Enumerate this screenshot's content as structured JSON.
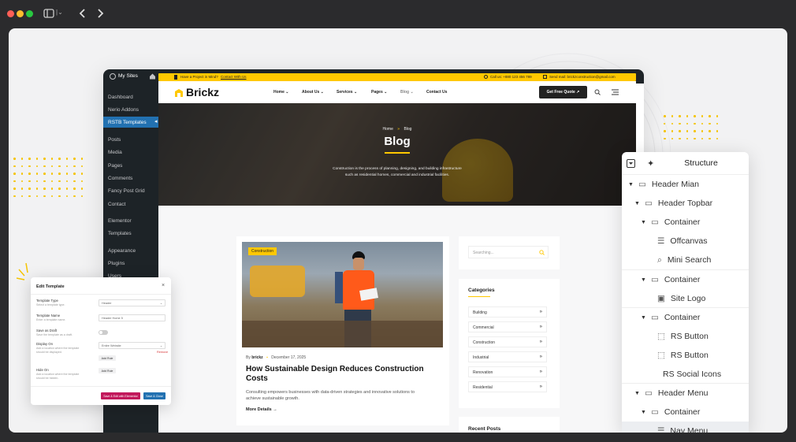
{
  "colors": {
    "accent": "#ffc800",
    "wp_dark": "#1d2327",
    "wp_active": "#2271b1",
    "pink": "#c2185b"
  },
  "browser": {
    "icons": [
      "close-dot",
      "minimize-dot",
      "maximize-dot",
      "sidebar-icon",
      "back-icon",
      "forward-icon"
    ]
  },
  "wp": {
    "my_sites": "My Sites",
    "menu": [
      "Dashboard",
      "Nerio Addons",
      "RSTB Templates",
      "Posts",
      "Media",
      "Pages",
      "Comments",
      "Fancy Post Grid",
      "Contact",
      "Elementor",
      "Templates",
      "Appearance",
      "Plugins",
      "Users"
    ]
  },
  "topbar": {
    "project": "Have a Project in Mind?",
    "contact": "Contact With Us",
    "call": "Call us: +880 123 456 789",
    "email": "Send mail: brickzconstruction@gmail.com"
  },
  "nav": {
    "logo": "Brickz",
    "links": [
      "Home",
      "About Us",
      "Services",
      "Pages",
      "Blog",
      "Contact Us"
    ],
    "cta": "Get Free Quote"
  },
  "hero": {
    "crumb_home": "Home",
    "crumb_sep": "»",
    "crumb_current": "Blog",
    "title": "Blog",
    "desc1": "Construction is the process of planning, designing, and building infrastructure",
    "desc2": "such as residential homes, commercial and industrial facilities."
  },
  "post": {
    "tag": "Construction",
    "by": "By",
    "author": "brickz",
    "date": "December 17, 2025",
    "title1": "How Sustainable Design Reduces Construction",
    "title2": "Costs",
    "excerpt1": "Consulting empowers businesses with data-driven strategies and innovative solutions to",
    "excerpt2": "achieve sustainable growth.",
    "more": "More Details"
  },
  "sidebar": {
    "search_placeholder": "Searching...",
    "categories_title": "Categories",
    "categories": [
      "Building",
      "Commercial",
      "Construction",
      "Industrial",
      "Renovation",
      "Residential"
    ],
    "recent_title": "Recent Posts"
  },
  "structure": {
    "title": "Structure",
    "items": [
      {
        "label": "Header Mian",
        "icon": "container-icon"
      },
      {
        "label": "Header Topbar",
        "icon": "container-icon"
      },
      {
        "label": "Container",
        "icon": "container-icon"
      },
      {
        "label": "Offcanvas",
        "icon": "offcanvas-icon"
      },
      {
        "label": "Mini Search",
        "icon": "search-icon"
      },
      {
        "label": "Container",
        "icon": "container-icon"
      },
      {
        "label": "Site Logo",
        "icon": "image-icon"
      },
      {
        "label": "Container",
        "icon": "container-icon"
      },
      {
        "label": "RS Button",
        "icon": "button-icon"
      },
      {
        "label": "RS Button",
        "icon": "button-icon"
      },
      {
        "label": "RS Social Icons",
        "icon": ""
      },
      {
        "label": "Header Menu",
        "icon": "container-icon"
      },
      {
        "label": "Container",
        "icon": "container-icon"
      },
      {
        "label": "Nav Menu",
        "icon": "nav-icon"
      }
    ]
  },
  "modal": {
    "title": "Edit Template",
    "type_label": "Template Type",
    "type_hint": "Select a template type.",
    "type_value": "Header",
    "name_label": "Template Name",
    "name_hint": "Enter a template name.",
    "name_value": "Header Home 5",
    "draft_label": "Save as Draft",
    "draft_hint": "Save the template as a draft.",
    "display_label": "Display On",
    "display_hint": "Add a location where the template should be displayed.",
    "display_value": "Entire Website",
    "remove": "Remove",
    "add_rule": "Add Rule",
    "hide_label": "Hide On",
    "hide_hint": "Add a location where the template should be hidden.",
    "btn_elementor": "Save & Edit with Elementor",
    "btn_close": "Save & Close"
  }
}
